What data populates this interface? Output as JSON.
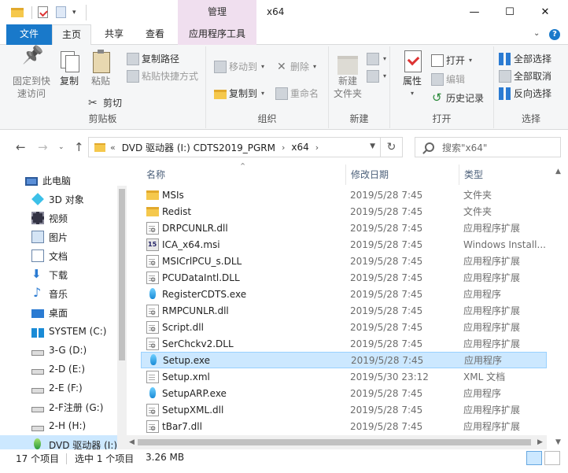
{
  "window": {
    "title": "x64",
    "context_tab_group": "管理",
    "min_glyph": "—",
    "max_glyph": "☐",
    "close_glyph": "✕"
  },
  "ribbon_tabs": {
    "file": "文件",
    "home": "主页",
    "share": "共享",
    "view": "查看",
    "app_tools": "应用程序工具"
  },
  "ribbon": {
    "clipboard": {
      "label": "剪贴板",
      "pin": "固定到快\n速访问",
      "pin_line1": "固定到快",
      "pin_line2": "速访问",
      "copy": "复制",
      "paste": "粘贴",
      "copy_path": "复制路径",
      "paste_shortcut": "粘贴快捷方式",
      "cut": "剪切"
    },
    "organize": {
      "label": "组织",
      "move_to": "移动到",
      "copy_to": "复制到",
      "delete": "删除",
      "rename": "重命名"
    },
    "new": {
      "label": "新建",
      "new_folder_line1": "新建",
      "new_folder_line2": "文件夹"
    },
    "open": {
      "label": "打开",
      "properties": "属性",
      "open": "打开",
      "edit": "编辑",
      "history": "历史记录"
    },
    "select": {
      "label": "选择",
      "select_all": "全部选择",
      "select_none": "全部取消",
      "invert": "反向选择"
    }
  },
  "address": {
    "overflow": "«",
    "segments": [
      "DVD 驱动器 (I:) CDTS2019_PGRM",
      "x64"
    ],
    "separator": "›",
    "search_placeholder": "搜索\"x64\""
  },
  "nav": [
    {
      "label": "此电脑",
      "icon": "pc-icon",
      "level": 0
    },
    {
      "label": "3D 对象",
      "icon": "3d-objects-icon",
      "level": 1
    },
    {
      "label": "视频",
      "icon": "video-icon",
      "level": 1
    },
    {
      "label": "图片",
      "icon": "pictures-icon",
      "level": 1
    },
    {
      "label": "文档",
      "icon": "documents-icon",
      "level": 1
    },
    {
      "label": "下载",
      "icon": "downloads-icon",
      "level": 1
    },
    {
      "label": "音乐",
      "icon": "music-icon",
      "level": 1
    },
    {
      "label": "桌面",
      "icon": "desktop-icon",
      "level": 1
    },
    {
      "label": "SYSTEM (C:)",
      "icon": "windows-drive-icon",
      "level": 1
    },
    {
      "label": "3-G (D:)",
      "icon": "drive-icon",
      "level": 1
    },
    {
      "label": "2-D (E:)",
      "icon": "drive-icon",
      "level": 1
    },
    {
      "label": "2-E (F:)",
      "icon": "drive-icon",
      "level": 1
    },
    {
      "label": "2-F注册 (G:)",
      "icon": "drive-icon",
      "level": 1
    },
    {
      "label": "2-H (H:)",
      "icon": "drive-icon",
      "level": 1
    },
    {
      "label": "DVD 驱动器 (I:)",
      "icon": "dvd-drive-icon",
      "level": 1,
      "selected": true
    }
  ],
  "columns": {
    "name": "名称",
    "date": "修改日期",
    "type": "类型"
  },
  "files": [
    {
      "name": "MSIs",
      "date": "2019/5/28 7:45",
      "type": "文件夹",
      "icon": "folder"
    },
    {
      "name": "Redist",
      "date": "2019/5/28 7:45",
      "type": "文件夹",
      "icon": "folder"
    },
    {
      "name": "DRPCUNLR.dll",
      "date": "2019/5/28 7:45",
      "type": "应用程序扩展",
      "icon": "dll"
    },
    {
      "name": "ICA_x64.msi",
      "date": "2019/5/28 7:45",
      "type": "Windows Install...",
      "icon": "msi"
    },
    {
      "name": "MSICrlPCU_s.DLL",
      "date": "2019/5/28 7:45",
      "type": "应用程序扩展",
      "icon": "dll"
    },
    {
      "name": "PCUDataIntl.DLL",
      "date": "2019/5/28 7:45",
      "type": "应用程序扩展",
      "icon": "dll"
    },
    {
      "name": "RegisterCDTS.exe",
      "date": "2019/5/28 7:45",
      "type": "应用程序",
      "icon": "exe"
    },
    {
      "name": "RMPCUNLR.dll",
      "date": "2019/5/28 7:45",
      "type": "应用程序扩展",
      "icon": "dll"
    },
    {
      "name": "Script.dll",
      "date": "2019/5/28 7:45",
      "type": "应用程序扩展",
      "icon": "dll"
    },
    {
      "name": "SerChckv2.DLL",
      "date": "2019/5/28 7:45",
      "type": "应用程序扩展",
      "icon": "dll"
    },
    {
      "name": "Setup.exe",
      "date": "2019/5/28 7:45",
      "type": "应用程序",
      "icon": "exe",
      "selected": true
    },
    {
      "name": "Setup.xml",
      "date": "2019/5/30 23:12",
      "type": "XML 文档",
      "icon": "xml"
    },
    {
      "name": "SetupARP.exe",
      "date": "2019/5/28 7:45",
      "type": "应用程序",
      "icon": "exe"
    },
    {
      "name": "SetupXML.dll",
      "date": "2019/5/28 7:45",
      "type": "应用程序扩展",
      "icon": "dll"
    },
    {
      "name": "tBar7.dll",
      "date": "2019/5/28 7:45",
      "type": "应用程序扩展",
      "icon": "dll"
    }
  ],
  "status": {
    "count": "17 个项目",
    "selected": "选中 1 个项目",
    "size": "3.26 MB"
  },
  "colors": {
    "accent": "#1979ca",
    "context_tab": "#f0dfef",
    "selection": "#cce8ff",
    "ribbon_bg": "#f5f6f7"
  }
}
